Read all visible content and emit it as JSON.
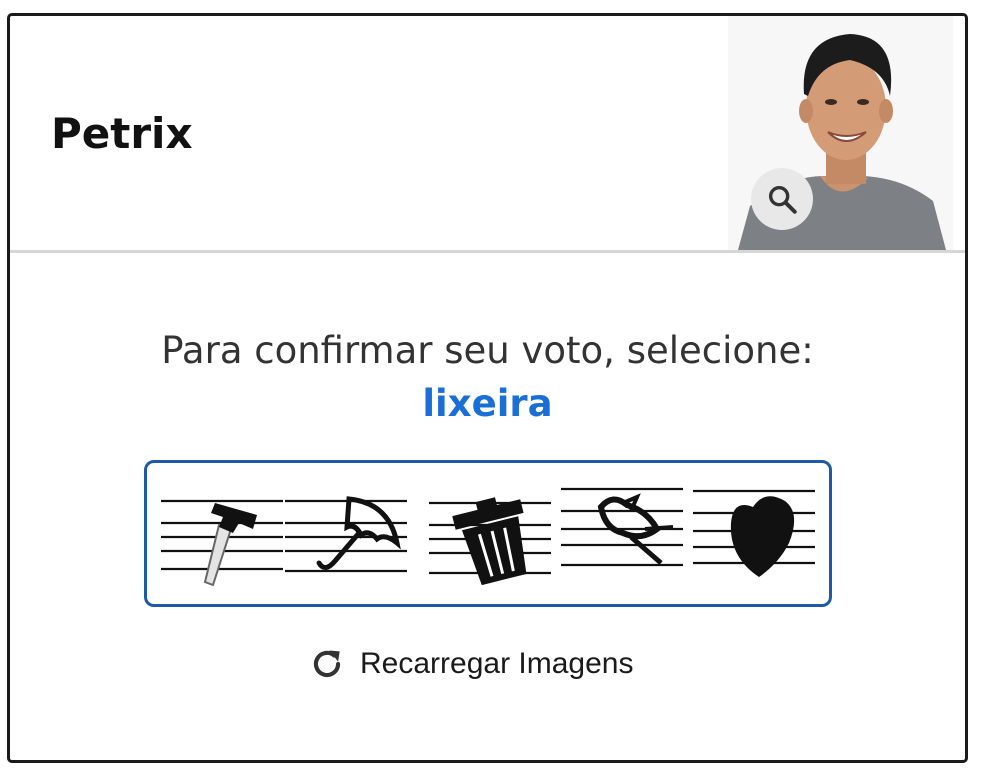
{
  "candidate": {
    "name": "Petrix"
  },
  "zoom": {
    "icon": "search-icon"
  },
  "captcha": {
    "prompt": "Para confirmar seu voto, selecione:",
    "target": "lixeira",
    "options": [
      {
        "icon": "hammer-icon"
      },
      {
        "icon": "umbrella-icon"
      },
      {
        "icon": "trash-can-icon"
      },
      {
        "icon": "bird-icon"
      },
      {
        "icon": "heart-icon"
      }
    ],
    "reload_label": "Recarregar Imagens",
    "reload_icon": "refresh-icon"
  },
  "colors": {
    "accent": "#1a6fd6",
    "captcha_border": "#1e5aa8",
    "divider": "#d6d6d6"
  }
}
